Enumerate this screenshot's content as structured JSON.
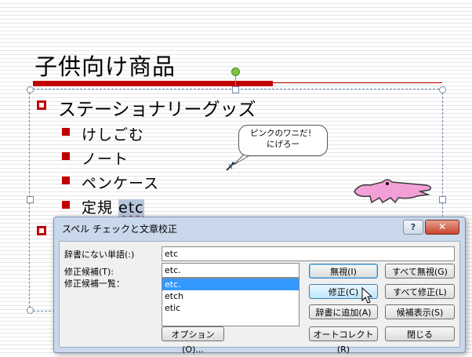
{
  "slide": {
    "title": "子供向け商品",
    "bullets": [
      {
        "text": "ステーショナリーグッズ",
        "sub": [
          {
            "text": "けしごむ"
          },
          {
            "text": "ノート"
          },
          {
            "text": "ペンケース"
          },
          {
            "prefix": "定規 ",
            "highlight": "etc"
          }
        ]
      }
    ],
    "callout": {
      "line1": "ピンクのワニだ！",
      "line2": "にげろー"
    }
  },
  "dialog": {
    "title": "スペル チェックと文章校正",
    "help_label": "?",
    "close_label": "✕",
    "not_in_dict_label": "辞書にない単語(:)",
    "not_in_dict_value": "etc",
    "change_to_label": "修正候補(T):",
    "change_to_value": "etc.",
    "suggestions_label": "修正候補一覧：",
    "suggestions": [
      "etc.",
      "etch",
      "etic"
    ],
    "selected_suggestion": "etc.",
    "buttons": {
      "ignore": "無視(I)",
      "ignore_all": "すべて無視(G)",
      "change": "修正(C)",
      "change_all": "すべて修正(L)",
      "add": "辞書に追加(A)",
      "suggest": "候補表示(S)",
      "options": "オプション(O)...",
      "autocorrect": "オートコレクト(R)",
      "close": "閉じる"
    }
  },
  "colors": {
    "accent": "#c00000",
    "dialog_frame": "#c9d8ea",
    "croc": "#f4a0d8"
  }
}
